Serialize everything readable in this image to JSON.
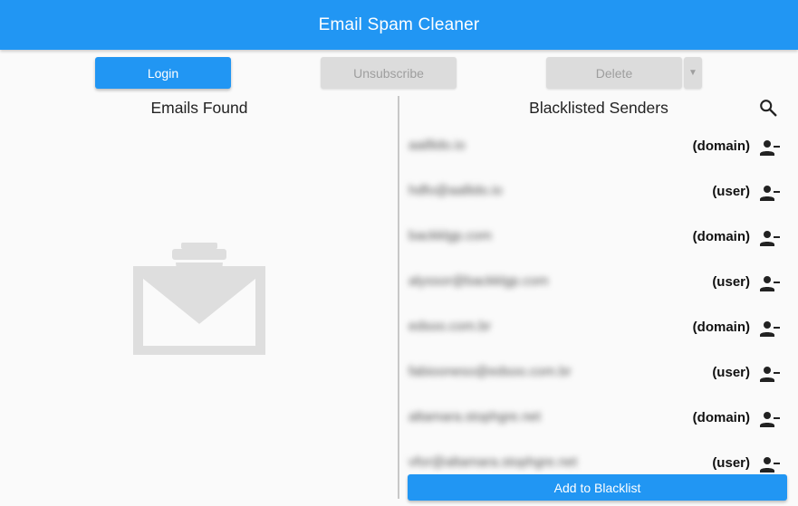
{
  "app": {
    "title": "Email Spam Cleaner"
  },
  "toolbar": {
    "login_label": "Login",
    "unsubscribe_label": "Unsubscribe",
    "delete_label": "Delete",
    "delete_menu_glyph": "▼"
  },
  "emails_panel": {
    "title": "Emails Found",
    "illustration_icon": "mail-trash-icon"
  },
  "blacklist_panel": {
    "title": "Blacklisted Senders",
    "search_icon": "search-icon",
    "remove_icon": "remove-user-icon",
    "add_label": "Add to Blacklist",
    "items": [
      {
        "sender": "aaillido.io",
        "type": "(domain)"
      },
      {
        "sender": "hdfo@aallido.io",
        "type": "(user)"
      },
      {
        "sender": "backklgp.com",
        "type": "(domain)"
      },
      {
        "sender": "alyssor@backklgp.com",
        "type": "(user)"
      },
      {
        "sender": "edsoo.com.br",
        "type": "(domain)"
      },
      {
        "sender": "fabiooneso@edsoo.com.br",
        "type": "(user)"
      },
      {
        "sender": "altamara.stophgre.net",
        "type": "(domain)"
      },
      {
        "sender": "vfor@altamara.stophgre.net",
        "type": "(user)"
      }
    ]
  },
  "colors": {
    "primary": "#2196f3",
    "disabled": "#dcdcdc",
    "background": "#fafafa"
  }
}
